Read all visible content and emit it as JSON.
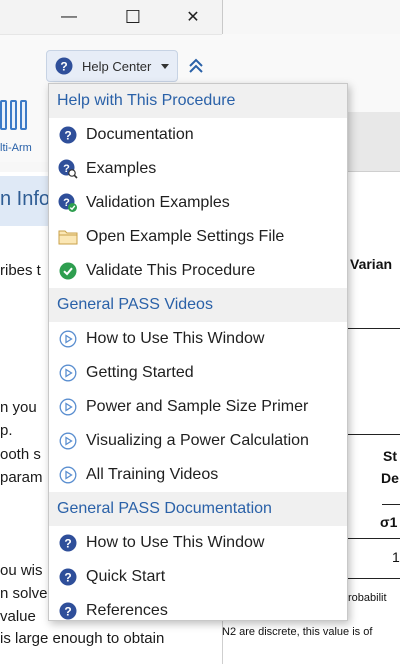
{
  "window": {
    "minimize_glyph": "—",
    "maximize_glyph": "☐",
    "close_glyph": "✕"
  },
  "toolbar": {
    "help_center_label": "Help Center"
  },
  "ribbon": {
    "label": "lti-Arm"
  },
  "left_panel": {
    "heading": "n Info",
    "lines": [
      "ribes t",
      "n you",
      "p.",
      "ooth s",
      "param",
      "ou wis",
      "n solve",
      "value",
      "is large enough to obtain"
    ]
  },
  "right_panel": {
    "col_header": "Varian",
    "table_header_line1": "St",
    "table_header_line2": "De",
    "sigma_label": "σ1",
    "value_1": "1",
    "footnote_1": "robabilit",
    "footnote_2": "N2 are discrete, this value is of"
  },
  "menu": {
    "sections": [
      {
        "title": "Help with This Procedure",
        "items": [
          {
            "label": "Documentation",
            "icon": "help-circle-icon"
          },
          {
            "label": "Examples",
            "icon": "help-search-icon"
          },
          {
            "label": "Validation Examples",
            "icon": "help-check-icon"
          },
          {
            "label": "Open Example Settings File",
            "icon": "folder-icon"
          },
          {
            "label": "Validate This Procedure",
            "icon": "check-circle-icon"
          }
        ]
      },
      {
        "title": "General PASS Videos",
        "items": [
          {
            "label": "How to Use This Window",
            "icon": "play-circle-icon"
          },
          {
            "label": "Getting Started",
            "icon": "play-circle-icon"
          },
          {
            "label": "Power and Sample Size Primer",
            "icon": "play-circle-icon"
          },
          {
            "label": "Visualizing a Power Calculation",
            "icon": "play-circle-icon"
          },
          {
            "label": "All Training Videos",
            "icon": "play-circle-icon"
          }
        ]
      },
      {
        "title": "General PASS Documentation",
        "items": [
          {
            "label": "How to Use This Window",
            "icon": "help-circle-icon"
          },
          {
            "label": "Quick Start",
            "icon": "help-circle-icon"
          },
          {
            "label": "References",
            "icon": "help-circle-icon"
          }
        ]
      }
    ]
  },
  "colors": {
    "accent_blue": "#2a61a8",
    "icon_navy": "#2f4f9a",
    "success_green": "#2e9e4f",
    "section_bg": "#f0f0f0"
  }
}
